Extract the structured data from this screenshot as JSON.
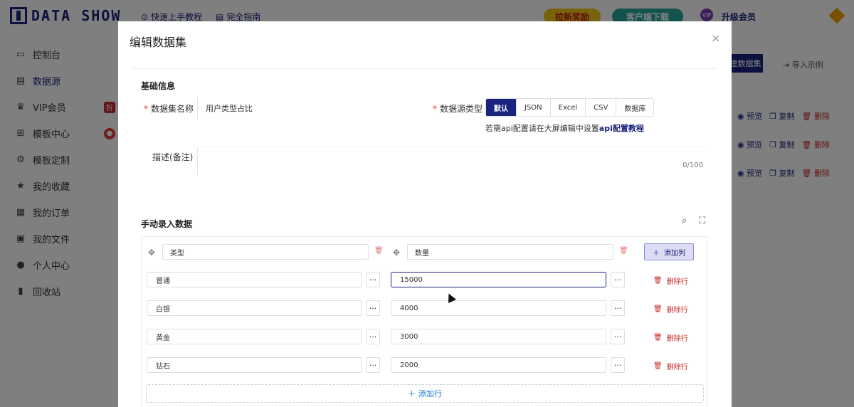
{
  "app": {
    "logo_text": "DATA SHOW",
    "top_links": [
      "快速上手教程",
      "完全指南"
    ],
    "promo_pills": [
      "拉新奖励",
      "客户端下载"
    ],
    "vip_badge": "VIP",
    "upgrade": "升级会员",
    "sidebar": [
      {
        "label": "控制台",
        "icon": "monitor-icon"
      },
      {
        "label": "数据源",
        "icon": "clipboard-icon"
      },
      {
        "label": "VIP会员",
        "icon": "vip-icon",
        "badge": "折"
      },
      {
        "label": "模板中心",
        "icon": "grid-icon"
      },
      {
        "label": "模板定制",
        "icon": "custom-icon"
      },
      {
        "label": "我的收藏",
        "icon": "star-icon"
      },
      {
        "label": "我的订单",
        "icon": "order-icon"
      },
      {
        "label": "我的文件",
        "icon": "image-icon"
      },
      {
        "label": "个人中心",
        "icon": "user-icon"
      },
      {
        "label": "回收站",
        "icon": "trash-icon"
      }
    ],
    "new_dataset_btn": "新建数据集",
    "demo_link": "导入示例",
    "row_actions": {
      "preview": "预览",
      "copy": "复制",
      "delete": "删除"
    }
  },
  "modal": {
    "title": "编辑数据集",
    "close": "×",
    "basic_info": "基础信息",
    "name_label": "数据集名称",
    "name_value": "用户类型占比",
    "source_label": "数据源类型",
    "source_types": [
      "默认",
      "JSON",
      "Excel",
      "CSV",
      "数据库"
    ],
    "source_selected": "默认",
    "api_hint": "若需api配置请在大屏编辑中设置",
    "api_link": "api配置教程",
    "desc_label": "描述(备注)",
    "desc_value": "",
    "desc_count": "0/100",
    "manual_title": "手动录入数据",
    "columns": [
      "类型",
      "数量"
    ],
    "add_col": "添加列",
    "rows": [
      {
        "type": "普通",
        "count": "15000"
      },
      {
        "type": "白银",
        "count": "4000"
      },
      {
        "type": "黄金",
        "count": "3000"
      },
      {
        "type": "钻石",
        "count": "2000"
      }
    ],
    "delete_row": "删除行",
    "add_row": "添加行",
    "more": "···"
  }
}
